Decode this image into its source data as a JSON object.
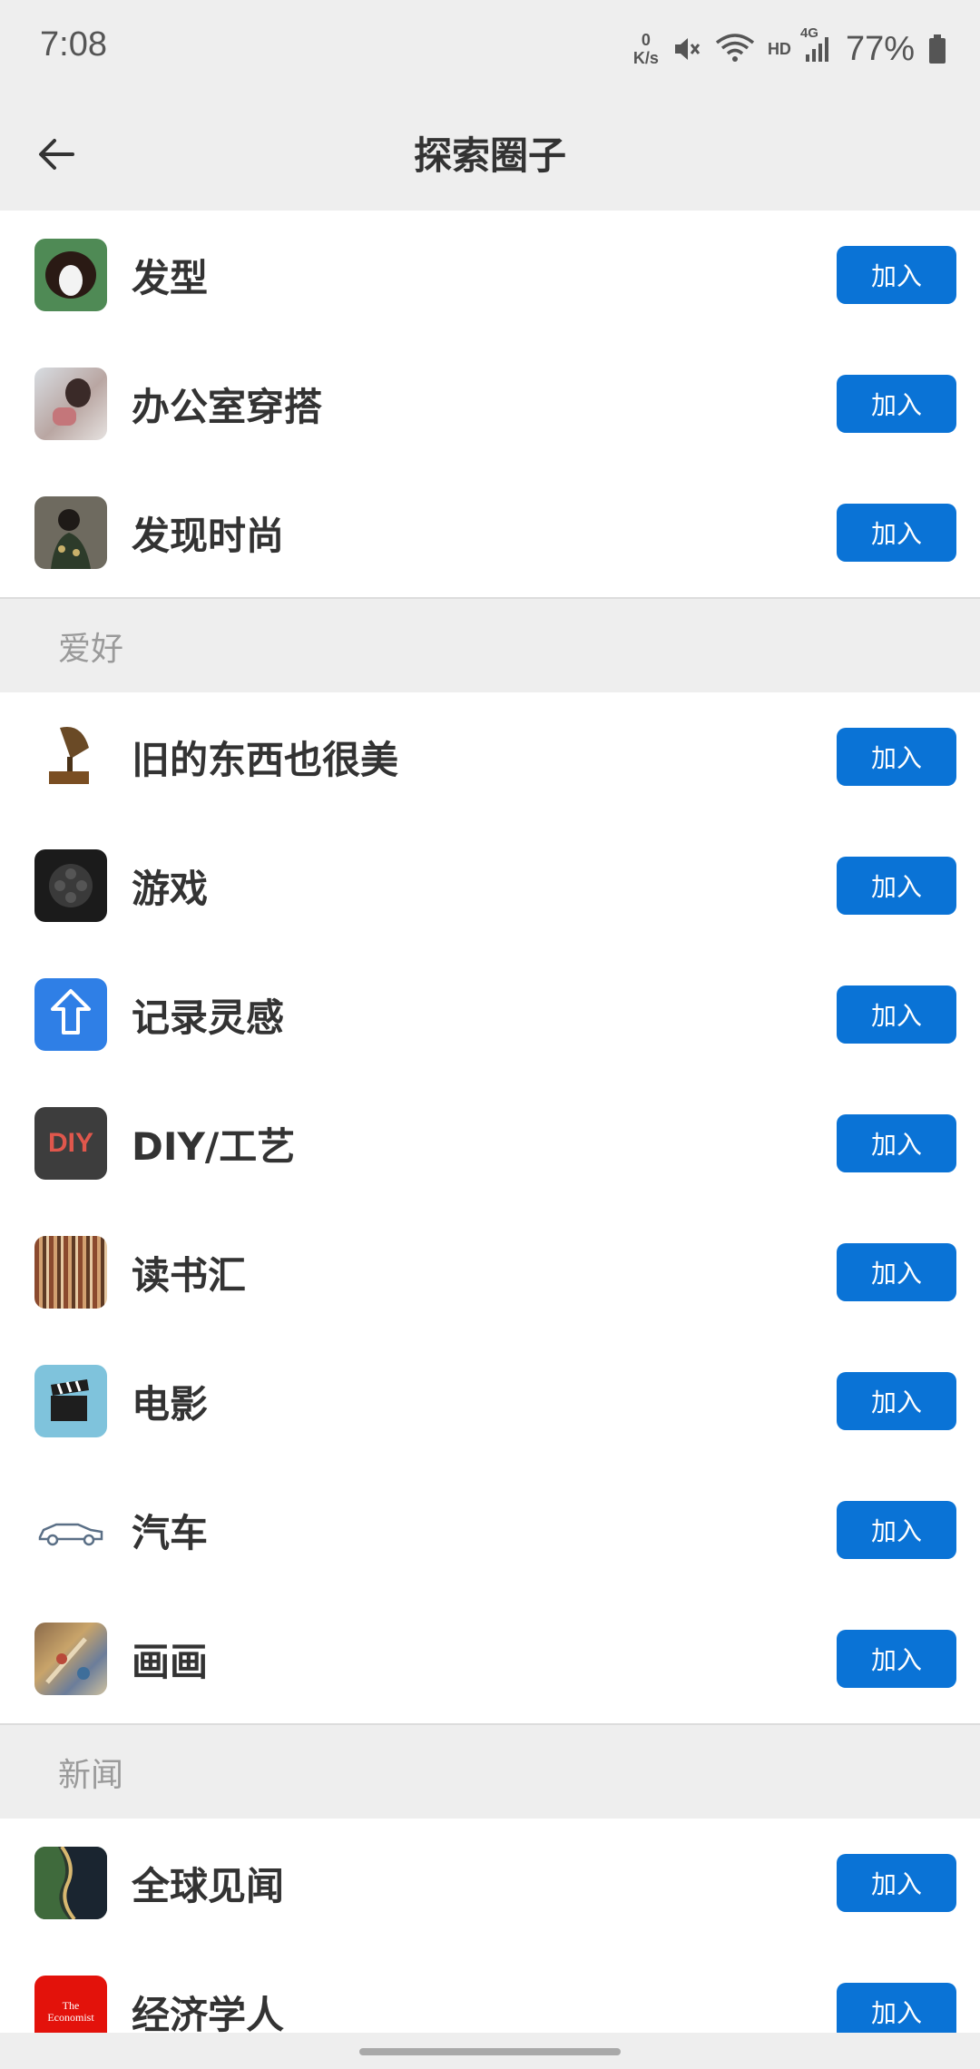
{
  "status_bar": {
    "time": "7:08",
    "net_speed_value": "0",
    "net_speed_unit": "K/s",
    "hd_label": "HD",
    "network_label": "4G",
    "battery": "77%",
    "icons": [
      "mute-icon",
      "wifi-icon",
      "signal-icon",
      "battery-icon"
    ]
  },
  "header": {
    "title": "探索圈子",
    "back_icon": "arrow-left-icon"
  },
  "top_group": {
    "items": [
      {
        "label": "发型",
        "icon": "hair-style-thumbnail",
        "button": "加入"
      },
      {
        "label": "办公室穿搭",
        "icon": "office-outfit-thumbnail",
        "button": "加入"
      },
      {
        "label": "发现时尚",
        "icon": "fashion-thumbnail",
        "button": "加入"
      }
    ]
  },
  "hobbies": {
    "header": "爱好",
    "items": [
      {
        "label": "旧的东西也很美",
        "icon": "gramophone-thumbnail",
        "button": "加入"
      },
      {
        "label": "游戏",
        "icon": "game-controller-thumbnail",
        "button": "加入"
      },
      {
        "label": "记录灵感",
        "icon": "upload-arrow-thumbnail",
        "button": "加入"
      },
      {
        "label": "DIY/工艺",
        "icon": "diy-thumbnail",
        "button": "加入",
        "thumb_text": "DIY"
      },
      {
        "label": "读书汇",
        "icon": "bookshelf-thumbnail",
        "button": "加入"
      },
      {
        "label": "电影",
        "icon": "clapperboard-thumbnail",
        "button": "加入"
      },
      {
        "label": "汽车",
        "icon": "car-thumbnail",
        "button": "加入"
      },
      {
        "label": "画画",
        "icon": "painting-thumbnail",
        "button": "加入"
      }
    ]
  },
  "news": {
    "header": "新闻",
    "items": [
      {
        "label": "全球见闻",
        "icon": "coastline-thumbnail",
        "button": "加入"
      },
      {
        "label": "经济学人",
        "icon": "economist-logo-thumbnail",
        "button": "加入",
        "thumb_text_1": "The",
        "thumb_text_2": "Economist"
      }
    ]
  },
  "colors": {
    "accent": "#0a73d6",
    "background": "#eeeeee",
    "list_background": "#ffffff"
  }
}
